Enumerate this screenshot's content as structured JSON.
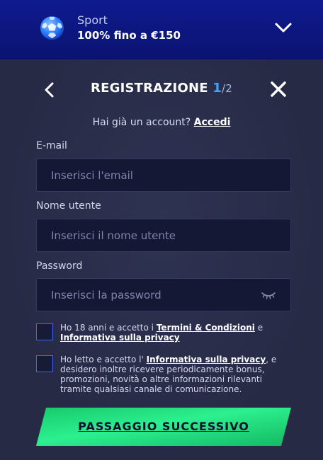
{
  "promo": {
    "icon": "soccer-ball-icon",
    "category": "Sport",
    "offer": "100% fino a €150",
    "expand_icon": "chevron-down-icon"
  },
  "header": {
    "title": "REGISTRAZIONE",
    "step": "1",
    "total": "/2",
    "back_icon": "chevron-left-icon",
    "close_icon": "close-icon"
  },
  "login": {
    "prompt": "Hai già un account?",
    "link": "Accedi"
  },
  "form": {
    "email": {
      "label": "E-mail",
      "placeholder": "Inserisci l'email",
      "value": ""
    },
    "username": {
      "label": "Nome utente",
      "placeholder": "Inserisci il nome utente",
      "value": ""
    },
    "password": {
      "label": "Password",
      "placeholder": "Inserisci la password",
      "value": "",
      "toggle_icon": "eye-closed-icon"
    }
  },
  "consents": [
    {
      "checked": false,
      "text_before": "Ho 18 anni e accetto i",
      "link1": "Termini & Condizioni",
      "text_mid": "e",
      "link2": "Informativa sulla privacy"
    },
    {
      "checked": false,
      "text_before": "Ho letto e accetto l'",
      "link": "Informativa sulla privacy",
      "text_after": ", e desidero inoltre ricevere periodicamente bonus, promozioni, novità o altre informazioni rilevanti tramite qualsiasi canale di comunicazione."
    }
  ],
  "cta": {
    "label": "PASSAGGIO SUCCESSIVO"
  },
  "colors": {
    "promo_bg": "#0f1a8f",
    "card_bg": "#262a45",
    "accent_blue": "#3fa3ff",
    "cta_green": "#1fd97a",
    "checkbox_border": "#3f63ff"
  }
}
